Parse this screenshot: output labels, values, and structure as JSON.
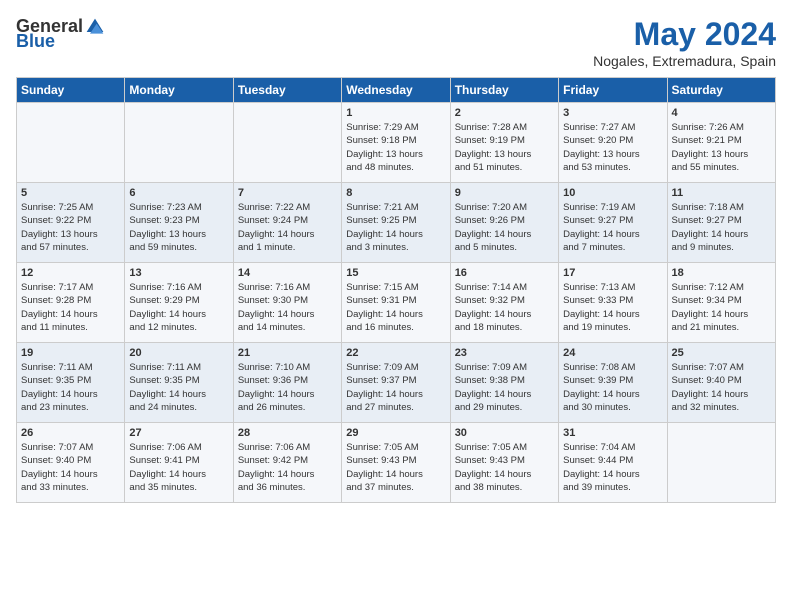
{
  "logo": {
    "general": "General",
    "blue": "Blue"
  },
  "title": "May 2024",
  "location": "Nogales, Extremadura, Spain",
  "headers": [
    "Sunday",
    "Monday",
    "Tuesday",
    "Wednesday",
    "Thursday",
    "Friday",
    "Saturday"
  ],
  "weeks": [
    [
      {
        "day": "",
        "info": ""
      },
      {
        "day": "",
        "info": ""
      },
      {
        "day": "",
        "info": ""
      },
      {
        "day": "1",
        "info": "Sunrise: 7:29 AM\nSunset: 9:18 PM\nDaylight: 13 hours\nand 48 minutes."
      },
      {
        "day": "2",
        "info": "Sunrise: 7:28 AM\nSunset: 9:19 PM\nDaylight: 13 hours\nand 51 minutes."
      },
      {
        "day": "3",
        "info": "Sunrise: 7:27 AM\nSunset: 9:20 PM\nDaylight: 13 hours\nand 53 minutes."
      },
      {
        "day": "4",
        "info": "Sunrise: 7:26 AM\nSunset: 9:21 PM\nDaylight: 13 hours\nand 55 minutes."
      }
    ],
    [
      {
        "day": "5",
        "info": "Sunrise: 7:25 AM\nSunset: 9:22 PM\nDaylight: 13 hours\nand 57 minutes."
      },
      {
        "day": "6",
        "info": "Sunrise: 7:23 AM\nSunset: 9:23 PM\nDaylight: 13 hours\nand 59 minutes."
      },
      {
        "day": "7",
        "info": "Sunrise: 7:22 AM\nSunset: 9:24 PM\nDaylight: 14 hours\nand 1 minute."
      },
      {
        "day": "8",
        "info": "Sunrise: 7:21 AM\nSunset: 9:25 PM\nDaylight: 14 hours\nand 3 minutes."
      },
      {
        "day": "9",
        "info": "Sunrise: 7:20 AM\nSunset: 9:26 PM\nDaylight: 14 hours\nand 5 minutes."
      },
      {
        "day": "10",
        "info": "Sunrise: 7:19 AM\nSunset: 9:27 PM\nDaylight: 14 hours\nand 7 minutes."
      },
      {
        "day": "11",
        "info": "Sunrise: 7:18 AM\nSunset: 9:27 PM\nDaylight: 14 hours\nand 9 minutes."
      }
    ],
    [
      {
        "day": "12",
        "info": "Sunrise: 7:17 AM\nSunset: 9:28 PM\nDaylight: 14 hours\nand 11 minutes."
      },
      {
        "day": "13",
        "info": "Sunrise: 7:16 AM\nSunset: 9:29 PM\nDaylight: 14 hours\nand 12 minutes."
      },
      {
        "day": "14",
        "info": "Sunrise: 7:16 AM\nSunset: 9:30 PM\nDaylight: 14 hours\nand 14 minutes."
      },
      {
        "day": "15",
        "info": "Sunrise: 7:15 AM\nSunset: 9:31 PM\nDaylight: 14 hours\nand 16 minutes."
      },
      {
        "day": "16",
        "info": "Sunrise: 7:14 AM\nSunset: 9:32 PM\nDaylight: 14 hours\nand 18 minutes."
      },
      {
        "day": "17",
        "info": "Sunrise: 7:13 AM\nSunset: 9:33 PM\nDaylight: 14 hours\nand 19 minutes."
      },
      {
        "day": "18",
        "info": "Sunrise: 7:12 AM\nSunset: 9:34 PM\nDaylight: 14 hours\nand 21 minutes."
      }
    ],
    [
      {
        "day": "19",
        "info": "Sunrise: 7:11 AM\nSunset: 9:35 PM\nDaylight: 14 hours\nand 23 minutes."
      },
      {
        "day": "20",
        "info": "Sunrise: 7:11 AM\nSunset: 9:35 PM\nDaylight: 14 hours\nand 24 minutes."
      },
      {
        "day": "21",
        "info": "Sunrise: 7:10 AM\nSunset: 9:36 PM\nDaylight: 14 hours\nand 26 minutes."
      },
      {
        "day": "22",
        "info": "Sunrise: 7:09 AM\nSunset: 9:37 PM\nDaylight: 14 hours\nand 27 minutes."
      },
      {
        "day": "23",
        "info": "Sunrise: 7:09 AM\nSunset: 9:38 PM\nDaylight: 14 hours\nand 29 minutes."
      },
      {
        "day": "24",
        "info": "Sunrise: 7:08 AM\nSunset: 9:39 PM\nDaylight: 14 hours\nand 30 minutes."
      },
      {
        "day": "25",
        "info": "Sunrise: 7:07 AM\nSunset: 9:40 PM\nDaylight: 14 hours\nand 32 minutes."
      }
    ],
    [
      {
        "day": "26",
        "info": "Sunrise: 7:07 AM\nSunset: 9:40 PM\nDaylight: 14 hours\nand 33 minutes."
      },
      {
        "day": "27",
        "info": "Sunrise: 7:06 AM\nSunset: 9:41 PM\nDaylight: 14 hours\nand 35 minutes."
      },
      {
        "day": "28",
        "info": "Sunrise: 7:06 AM\nSunset: 9:42 PM\nDaylight: 14 hours\nand 36 minutes."
      },
      {
        "day": "29",
        "info": "Sunrise: 7:05 AM\nSunset: 9:43 PM\nDaylight: 14 hours\nand 37 minutes."
      },
      {
        "day": "30",
        "info": "Sunrise: 7:05 AM\nSunset: 9:43 PM\nDaylight: 14 hours\nand 38 minutes."
      },
      {
        "day": "31",
        "info": "Sunrise: 7:04 AM\nSunset: 9:44 PM\nDaylight: 14 hours\nand 39 minutes."
      },
      {
        "day": "",
        "info": ""
      }
    ]
  ]
}
